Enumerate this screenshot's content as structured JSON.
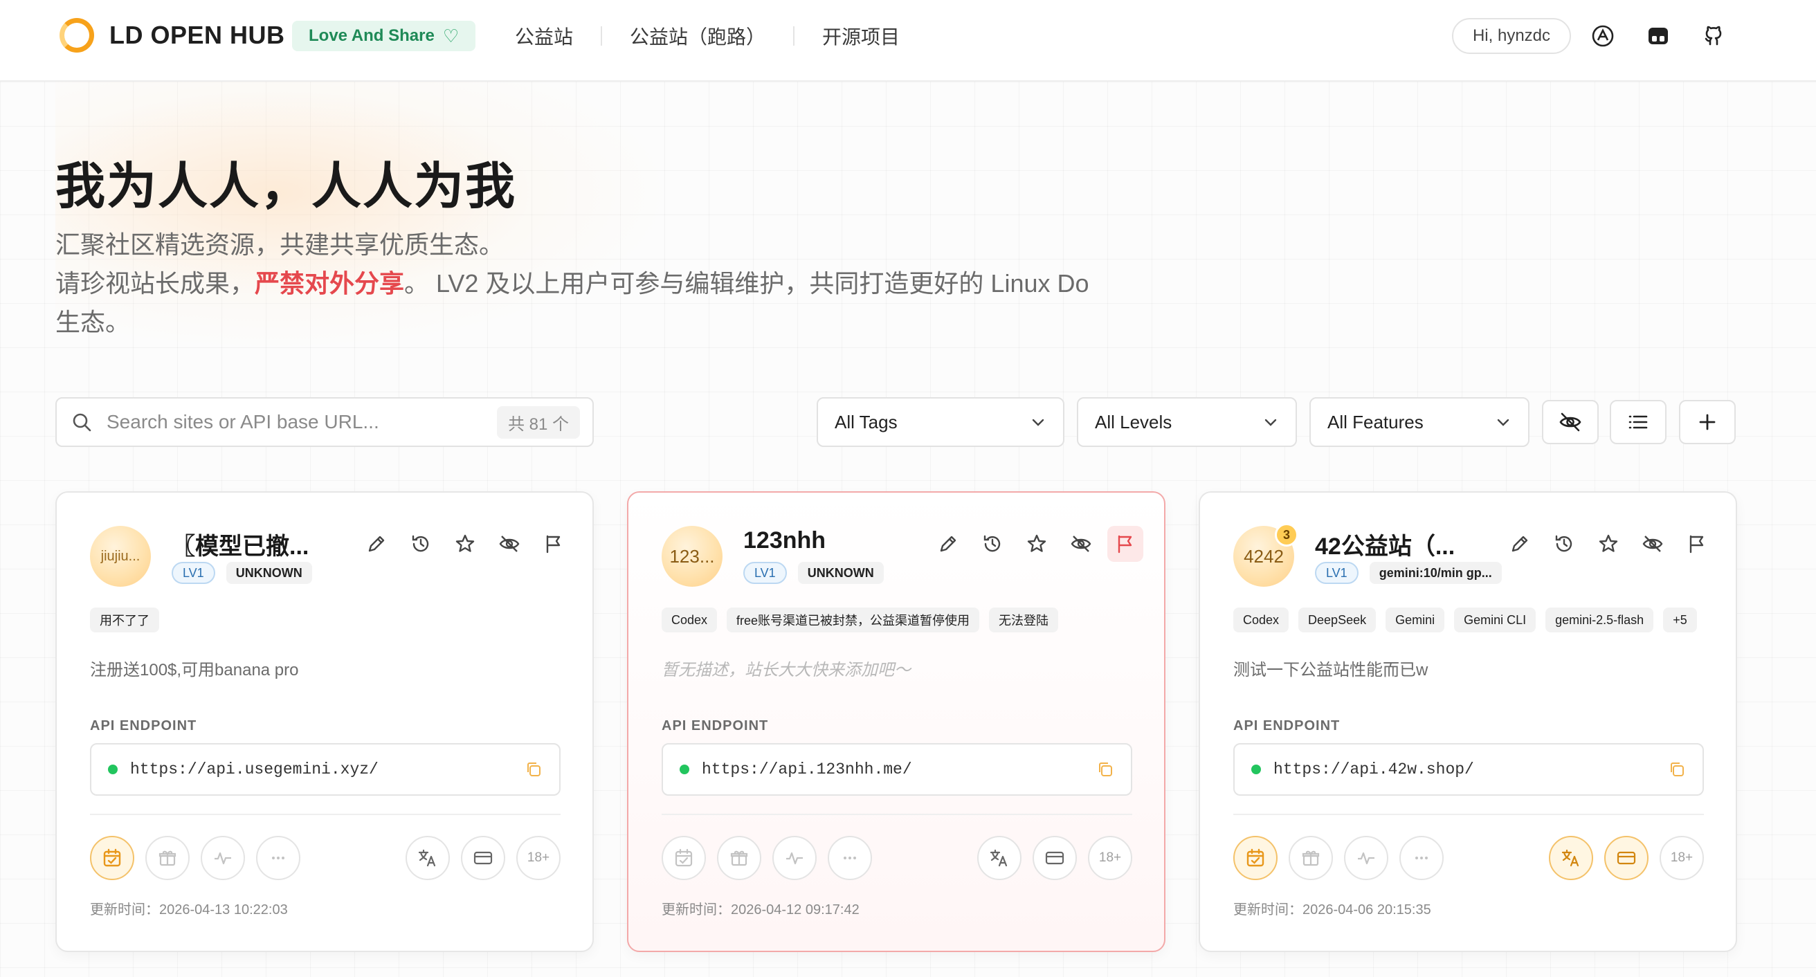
{
  "nav": {
    "brand": "LD OPEN HUB",
    "badge": "Love And Share",
    "links": [
      "公益站",
      "公益站（跑路）",
      "开源项目"
    ],
    "greeting": "Hi, hynzdc"
  },
  "hero": {
    "title": "我为人人，人人为我",
    "line1": "汇聚社区精选资源，共建共享优质生态。",
    "line2_pre": "请珍视站长成果，",
    "line2_warn": "严禁对外分享",
    "line2_post": "。 LV2 及以上用户可参与编辑维护，共同打造更好的 Linux Do",
    "line3": "生态。"
  },
  "toolbar": {
    "search_placeholder": "Search sites or API base URL...",
    "search_count": "共 81 个",
    "tags_select": "All Tags",
    "levels_select": "All Levels",
    "features_select": "All Features"
  },
  "labels": {
    "api_endpoint": "API ENDPOINT",
    "adult": "18+"
  },
  "cards": [
    {
      "avatar": "jiujiu...",
      "title": "〖模型已撤...",
      "level": "LV1",
      "status": "UNKNOWN",
      "tags": [
        "用不了了"
      ],
      "description": "注册送100$,可用banana pro",
      "endpoint": "https://api.usegemini.xyz/",
      "updated": "更新时间：2026-04-13 10:22:03"
    },
    {
      "avatar": "123...",
      "title": "123nhh",
      "level": "LV1",
      "status": "UNKNOWN",
      "tags": [
        "Codex",
        "free账号渠道已被封禁，公益渠道暂停使用",
        "无法登陆"
      ],
      "description": "暂无描述，站长大大快来添加吧～",
      "endpoint": "https://api.123nhh.me/",
      "updated": "更新时间：2026-04-12 09:17:42"
    },
    {
      "avatar": "4242",
      "avatar_badge": "3",
      "title": "42公益站（...",
      "level": "LV1",
      "status": "gemini:10/min gp...",
      "tags": [
        "Codex",
        "DeepSeek",
        "Gemini",
        "Gemini CLI",
        "gemini-2.5-flash",
        "+5"
      ],
      "description": "测试一下公益站性能而已w",
      "endpoint": "https://api.42w.shop/",
      "updated": "更新时间：2026-04-06 20:15:35"
    }
  ],
  "colors": {
    "accent_orange": "#f7a21b",
    "badge_green": "#1f8a57",
    "danger_red": "#e5484d",
    "status_green": "#22c55e"
  }
}
